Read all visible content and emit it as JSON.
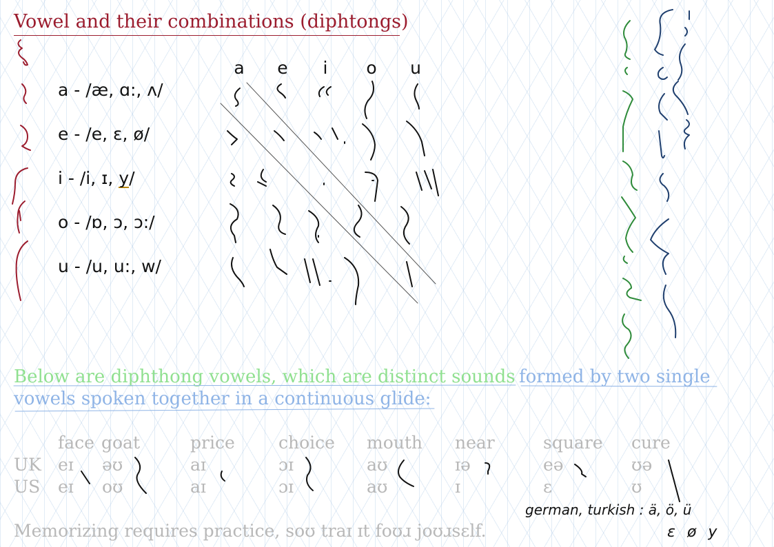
{
  "title": "Vowel and their combinations (diphtongs)",
  "vowel_rows": [
    {
      "label": "a - /æ, ɑ:, ʌ/"
    },
    {
      "label": "e - /e, ɛ, ø/"
    },
    {
      "label_pre": "i  - /i, ɪ, ",
      "label_y": "y",
      "label_post": "/"
    },
    {
      "label": "o - /ɒ, ɔ, ɔ:/"
    },
    {
      "label": "u - /u, u:, w/"
    }
  ],
  "matrix_headers": [
    "a",
    "e",
    "i",
    "o",
    "u"
  ],
  "paragraph": {
    "green_part": "Below are diphthong vowels, which are distinct sounds",
    "blue_part_line1": "formed by two single",
    "blue_part_line2": "vowels spoken together in a continuous glide:"
  },
  "diphthong_table": {
    "row_labels": [
      "UK",
      "US"
    ],
    "columns": [
      {
        "name": "face",
        "uk": "eɪ",
        "us": "eɪ"
      },
      {
        "name": "goat",
        "uk": "əʊ",
        "us": "oʊ"
      },
      {
        "name": "price",
        "uk": "aɪ",
        "us": "aɪ"
      },
      {
        "name": "choice",
        "uk": "ɔɪ",
        "us": "ɔɪ"
      },
      {
        "name": "mouth",
        "uk": "aʊ",
        "us": "aʊ"
      },
      {
        "name": "near",
        "uk": "ɪə",
        "us": "ɪ"
      },
      {
        "name": "square",
        "uk": "eə",
        "us": "ɛ"
      },
      {
        "name": "cure",
        "uk": "ʊə",
        "us": "ʊ"
      }
    ]
  },
  "footer": "Memorizing requires practice, soʊ traɪ ɪt foʊɹ joʊɹsɛlf.",
  "handwritten_note": {
    "line1": "german, turkish : ä, ö, ü",
    "line2": "ɛ  ø  y"
  },
  "colors": {
    "title": "#9b1c2e",
    "green_text": "#90e090",
    "blue_text": "#8fb4e6",
    "gray_text": "#b8b8b8",
    "ink_black": "#111111",
    "ink_red": "#9b1c2e",
    "ink_green": "#2e8b3a",
    "ink_navy": "#1f3f6e"
  }
}
